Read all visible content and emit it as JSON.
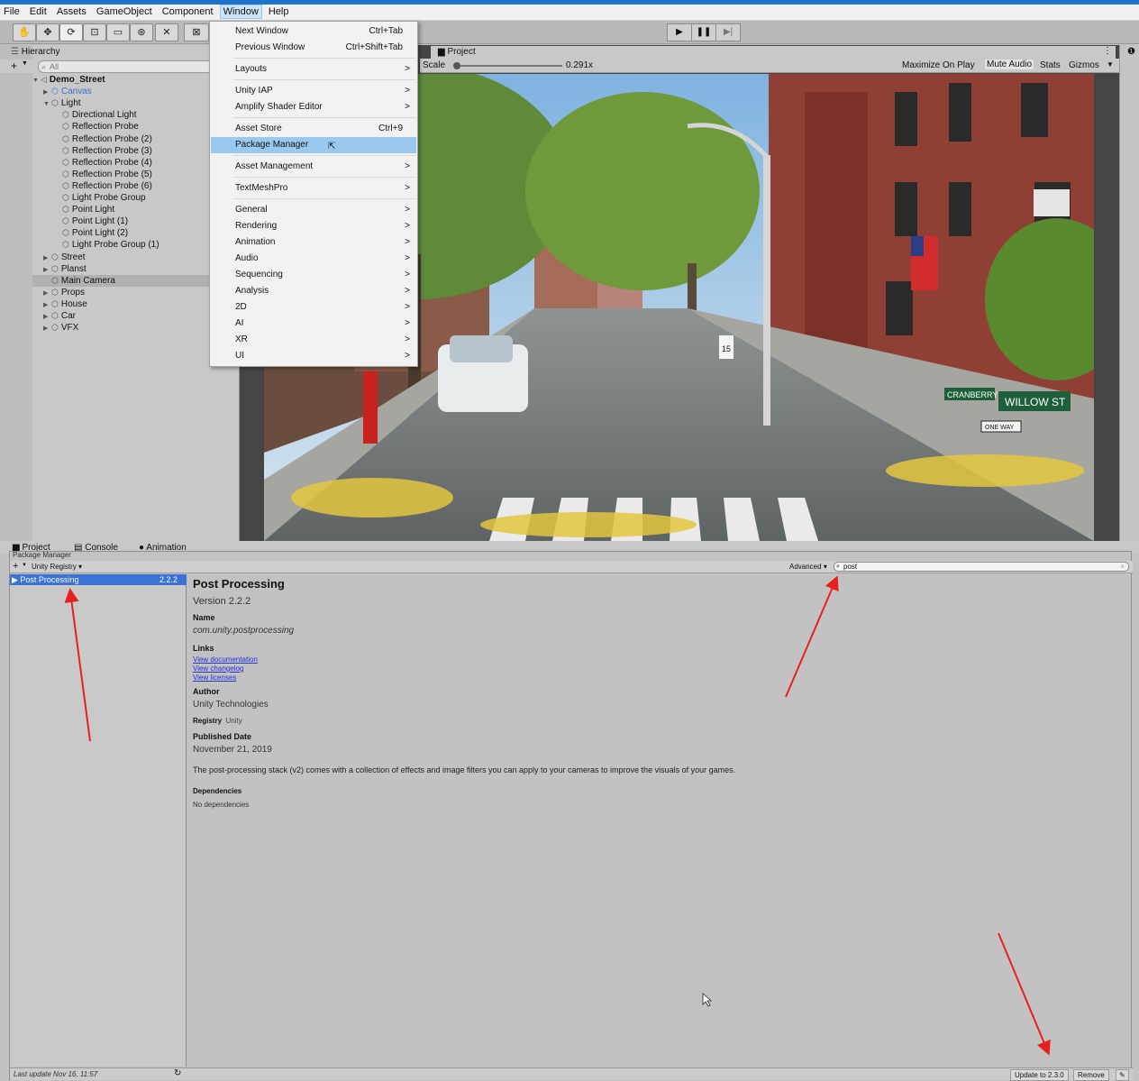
{
  "menubar": {
    "items": [
      "File",
      "Edit",
      "Assets",
      "GameObject",
      "Component",
      "Window",
      "Help"
    ],
    "active": "Window"
  },
  "window_menu": {
    "items": [
      {
        "label": "Next Window",
        "shortcut": "Ctrl+Tab",
        "submenu": false
      },
      {
        "label": "Previous Window",
        "shortcut": "Ctrl+Shift+Tab",
        "submenu": false
      },
      {
        "label": "Layouts",
        "shortcut": "",
        "submenu": true
      },
      {
        "label": "Unity IAP",
        "shortcut": "",
        "submenu": true
      },
      {
        "label": "Amplify Shader Editor",
        "shortcut": "",
        "submenu": true
      },
      {
        "label": "Asset Store",
        "shortcut": "Ctrl+9",
        "submenu": false
      },
      {
        "label": "Package Manager",
        "shortcut": "",
        "submenu": false,
        "highlighted": true
      },
      {
        "label": "Asset Management",
        "shortcut": "",
        "submenu": true
      },
      {
        "label": "TextMeshPro",
        "shortcut": "",
        "submenu": true
      },
      {
        "label": "General",
        "shortcut": "",
        "submenu": true
      },
      {
        "label": "Rendering",
        "shortcut": "",
        "submenu": true
      },
      {
        "label": "Animation",
        "shortcut": "",
        "submenu": true
      },
      {
        "label": "Audio",
        "shortcut": "",
        "submenu": true
      },
      {
        "label": "Sequencing",
        "shortcut": "",
        "submenu": true
      },
      {
        "label": "Analysis",
        "shortcut": "",
        "submenu": true
      },
      {
        "label": "2D",
        "shortcut": "",
        "submenu": true
      },
      {
        "label": "AI",
        "shortcut": "",
        "submenu": true
      },
      {
        "label": "XR",
        "shortcut": "",
        "submenu": true
      },
      {
        "label": "UI",
        "shortcut": "",
        "submenu": true
      }
    ],
    "arrow_glyph": ">"
  },
  "hierarchy": {
    "tab": "Hierarchy",
    "search_placeholder": "All",
    "plus": "+",
    "rows": [
      {
        "label": "Demo_Street",
        "depth": 0,
        "expanded": true,
        "bold": true
      },
      {
        "label": "Canvas",
        "depth": 1,
        "expanded": false,
        "blue": true
      },
      {
        "label": "Light",
        "depth": 1,
        "expanded": true
      },
      {
        "label": "Directional Light",
        "depth": 2
      },
      {
        "label": "Reflection Probe",
        "depth": 2
      },
      {
        "label": "Reflection Probe (2)",
        "depth": 2
      },
      {
        "label": "Reflection Probe (3)",
        "depth": 2
      },
      {
        "label": "Reflection Probe (4)",
        "depth": 2
      },
      {
        "label": "Reflection Probe (5)",
        "depth": 2
      },
      {
        "label": "Reflection Probe (6)",
        "depth": 2
      },
      {
        "label": "Light Probe Group",
        "depth": 2
      },
      {
        "label": "Point Light",
        "depth": 2
      },
      {
        "label": "Point Light (1)",
        "depth": 2
      },
      {
        "label": "Point Light (2)",
        "depth": 2
      },
      {
        "label": "Light Probe Group (1)",
        "depth": 2
      },
      {
        "label": "Street",
        "depth": 1,
        "expanded": false
      },
      {
        "label": "Planst",
        "depth": 1,
        "expanded": false
      },
      {
        "label": "Main Camera",
        "depth": 1,
        "selected": true
      },
      {
        "label": "Props",
        "depth": 1,
        "expanded": false
      },
      {
        "label": "House",
        "depth": 1,
        "expanded": false
      },
      {
        "label": "Car",
        "depth": 1,
        "expanded": false
      },
      {
        "label": "VFX",
        "depth": 1,
        "expanded": false
      }
    ]
  },
  "game": {
    "project_tab": "Project",
    "scale_label": "Scale",
    "scale_value": "0.291x",
    "buttons": [
      "Maximize On Play",
      "Mute Audio",
      "Stats",
      "Gizmos"
    ],
    "signs": {
      "cranberry": "CRANBERRY ST",
      "willow": "WILLOW ST",
      "one_way": "ONE WAY",
      "speed": "15"
    }
  },
  "lower_tabs": [
    "Project",
    "Console",
    "Animation"
  ],
  "package_manager": {
    "title": "Package Manager",
    "scope": "Unity Registry",
    "advanced": "Advanced",
    "search_value": "post",
    "list": [
      {
        "name": "Post Processing",
        "version": "2.2.2"
      }
    ],
    "detail": {
      "title": "Post Processing",
      "version": "Version 2.2.2",
      "name_label": "Name",
      "name_value": "com.unity.postprocessing",
      "links_label": "Links",
      "links": [
        "View documentation",
        "View changelog",
        "View licenses"
      ],
      "author_label": "Author",
      "author_value": "Unity Technologies",
      "registry_label": "Registry",
      "registry_value": "Unity",
      "published_label": "Published Date",
      "published_value": "November 21,  2019",
      "description": "The post-processing stack (v2) comes with a collection of effects and image filters you can apply to your cameras to improve the visuals of your games.",
      "deps_label": "Dependencies",
      "deps_value": "No dependencies"
    },
    "status": "Last update Nov 16, 11:57",
    "update_button": "Update to 2.3.0",
    "remove_button": "Remove"
  },
  "colors": {
    "accent": "#1f73c9",
    "menu_highlight": "#99c9ef",
    "selection": "#3a72d8",
    "arrow": "#e8201c"
  }
}
